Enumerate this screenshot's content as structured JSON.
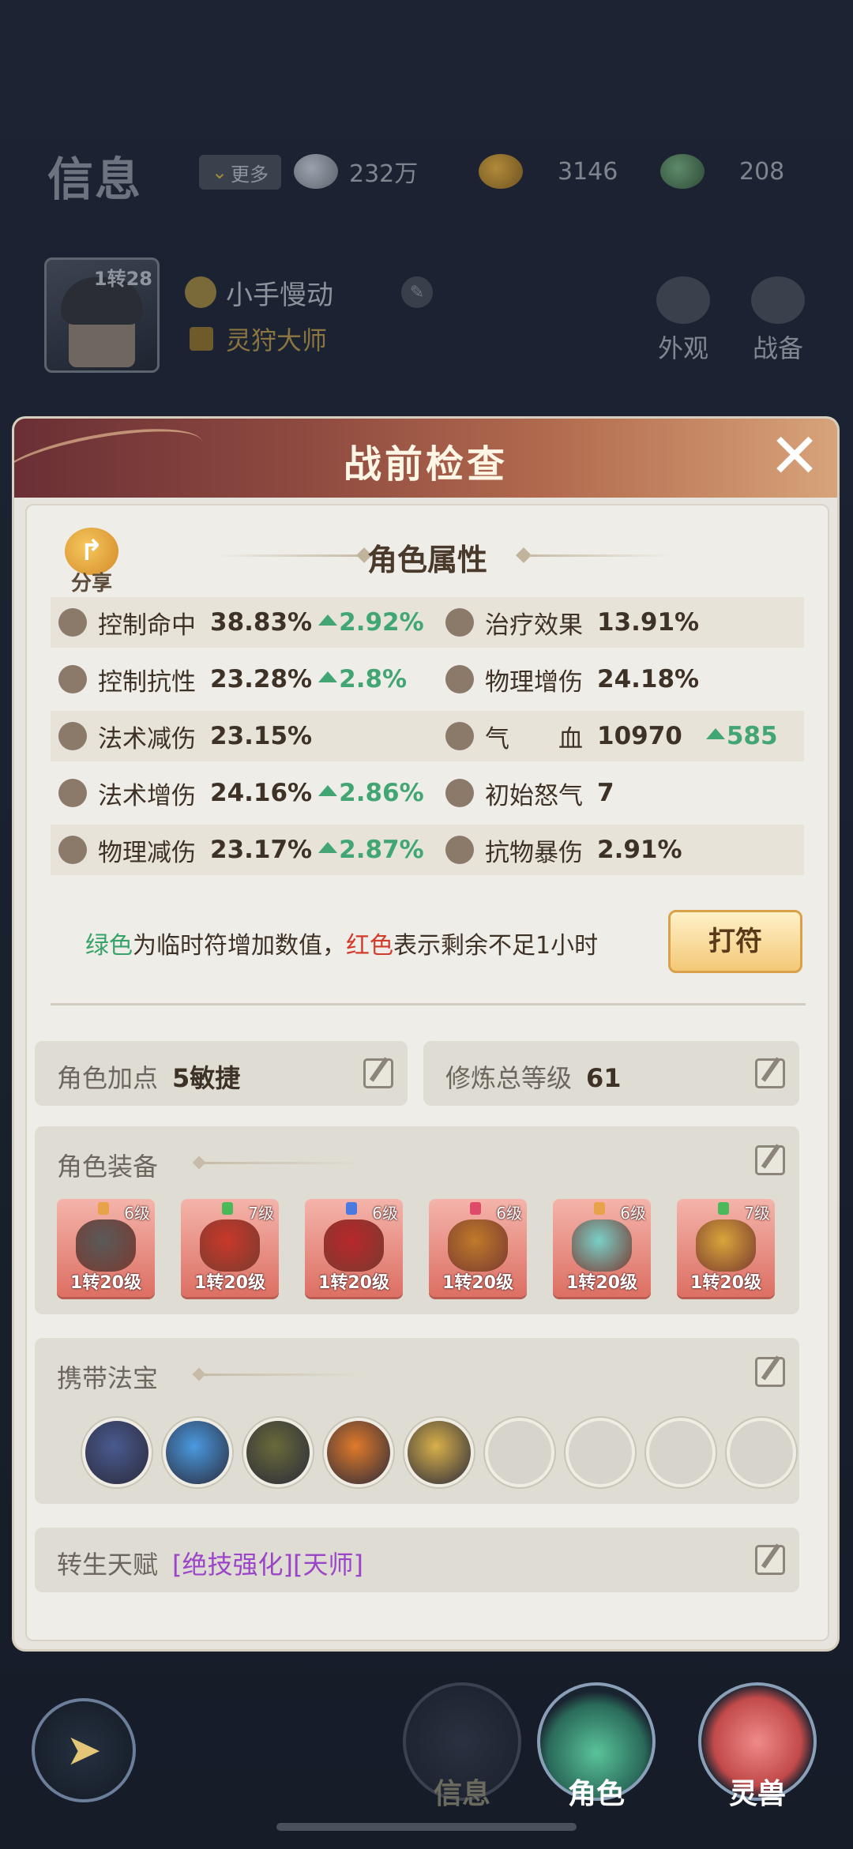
{
  "header": {
    "title": "信息",
    "more_label": "更多",
    "currencies": [
      {
        "icon": "silver-ingot-icon",
        "value": "232万"
      },
      {
        "icon": "gold-ingot-icon",
        "value": "3146"
      },
      {
        "icon": "jade-icon",
        "value": "208"
      }
    ]
  },
  "player": {
    "level": "1转28",
    "name": "小手慢动",
    "title": "灵狩大师",
    "buttons": [
      "外观",
      "战备"
    ]
  },
  "modal": {
    "title": "战前检查",
    "share_label": "分享",
    "section_title": "角色属性",
    "attributes": [
      {
        "name": "控制命中",
        "value": "38.83%",
        "bonus": "2.92%"
      },
      {
        "name": "治疗效果",
        "value": "13.91%",
        "bonus": ""
      },
      {
        "name": "控制抗性",
        "value": "23.28%",
        "bonus": "2.8%"
      },
      {
        "name": "物理增伤",
        "value": "24.18%",
        "bonus": ""
      },
      {
        "name": "法术减伤",
        "value": "23.15%",
        "bonus": ""
      },
      {
        "name": "气　　血",
        "value": "10970",
        "bonus": "585"
      },
      {
        "name": "法术增伤",
        "value": "24.16%",
        "bonus": "2.86%"
      },
      {
        "name": "初始怒气",
        "value": "7",
        "bonus": ""
      },
      {
        "name": "物理减伤",
        "value": "23.17%",
        "bonus": "2.87%"
      },
      {
        "name": "抗物暴伤",
        "value": "2.91%",
        "bonus": ""
      }
    ],
    "note": {
      "green": "绿色",
      "mid": "为临时符增加数值，",
      "red": "红色",
      "tail": "表示剩余不足1小时"
    },
    "dafu_button": "打符",
    "points": {
      "label": "角色加点",
      "value": "5敏捷"
    },
    "cultivation": {
      "label": "修炼总等级",
      "value": "61"
    },
    "equipment": {
      "label": "角色装备",
      "items": [
        {
          "grade": "6级",
          "level": "1转20级",
          "gem_color": "#e8a24a",
          "art_color": "#5a5a5a"
        },
        {
          "grade": "7级",
          "level": "1转20级",
          "gem_color": "#4bb85a",
          "art_color": "#c8392a"
        },
        {
          "grade": "6级",
          "level": "1转20级",
          "gem_color": "#4a7ae0",
          "art_color": "#b8282a"
        },
        {
          "grade": "6级",
          "level": "1转20级",
          "gem_color": "#e04a6a",
          "art_color": "#c07a2a"
        },
        {
          "grade": "6级",
          "level": "1转20级",
          "gem_color": "#e8a24a",
          "art_color": "#7ad0c8"
        },
        {
          "grade": "7级",
          "level": "1转20级",
          "gem_color": "#4bb85a",
          "art_color": "#d8a63a"
        }
      ]
    },
    "treasures": {
      "label": "携带法宝",
      "items": [
        {
          "name": "scroll-treasure-icon",
          "color": "#4a5a90"
        },
        {
          "name": "yin-yang-treasure-icon",
          "color": "#4a9ae0"
        },
        {
          "name": "bell-treasure-icon",
          "color": "#6a6a3a"
        },
        {
          "name": "fire-treasure-icon",
          "color": "#e07a2a"
        },
        {
          "name": "dragon-treasure-icon",
          "color": "#d8b04a"
        },
        {
          "name": "empty-slot",
          "color": "#d7d4cc"
        },
        {
          "name": "empty-slot",
          "color": "#d7d4cc"
        },
        {
          "name": "empty-slot",
          "color": "#d7d4cc"
        },
        {
          "name": "empty-slot",
          "color": "#d7d4cc"
        }
      ]
    },
    "talent": {
      "label": "转生天赋",
      "value": "[绝技强化][天师]"
    }
  },
  "bottom_nav": {
    "items": [
      "信息",
      "角色",
      "灵兽"
    ]
  }
}
